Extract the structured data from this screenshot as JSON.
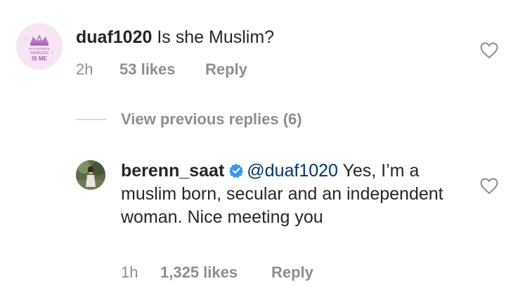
{
  "comment": {
    "username": "duaf1020",
    "text": "Is she Muslim?",
    "time": "2h",
    "likes": "53 likes",
    "reply_label": "Reply",
    "avatar_text_top": "MY FAVORITE",
    "avatar_text_mid": "PRINCESS",
    "avatar_text_bottom": "IS ME"
  },
  "view_previous": {
    "label": "View previous replies (6)"
  },
  "reply": {
    "username": "berenn_saat",
    "mention": "@duaf1020",
    "text": "Yes, I’m a muslim born, secular and an independent woman. Nice meeting you",
    "time": "1h",
    "likes": "1,325 likes",
    "reply_label": "Reply"
  },
  "colors": {
    "primary_text": "#262626",
    "secondary_text": "#8e8e8e",
    "mention": "#003569",
    "verified": "#3897f0"
  },
  "icons": {
    "like": "heart-outline-icon",
    "verified": "verified-badge-icon"
  }
}
